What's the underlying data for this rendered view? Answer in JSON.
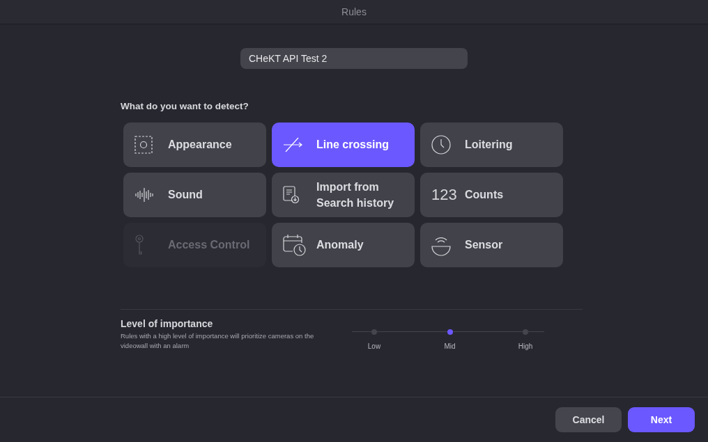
{
  "window": {
    "title": "Rules"
  },
  "rule_name": {
    "value": "CHeKT API Test 2"
  },
  "question": "What do you want to detect?",
  "detection_types": [
    {
      "label": "Appearance",
      "kind": "appearance",
      "selected": false,
      "disabled": false
    },
    {
      "label": "Line crossing",
      "kind": "line",
      "selected": true,
      "disabled": false
    },
    {
      "label": "Loitering",
      "kind": "clock",
      "selected": false,
      "disabled": false
    },
    {
      "label": "Sound",
      "kind": "sound",
      "selected": false,
      "disabled": false
    },
    {
      "label": "Import from Search history",
      "kind": "import",
      "selected": false,
      "disabled": false
    },
    {
      "label": "Counts",
      "kind": "counts",
      "icon_text": "123",
      "selected": false,
      "disabled": false
    },
    {
      "label": "Access Control",
      "kind": "key",
      "selected": false,
      "disabled": true
    },
    {
      "label": "Anomaly",
      "kind": "calendar",
      "selected": false,
      "disabled": false
    },
    {
      "label": "Sensor",
      "kind": "sensor",
      "selected": false,
      "disabled": false
    }
  ],
  "importance": {
    "title": "Level of importance",
    "description": "Rules with a high level of importance will prioritize cameras on the videowall with an alarm",
    "levels": [
      {
        "label": "Low",
        "selected": false
      },
      {
        "label": "Mid",
        "selected": true
      },
      {
        "label": "High",
        "selected": false
      }
    ]
  },
  "buttons": [
    {
      "label": "Cancel",
      "kind": "secondary"
    },
    {
      "label": "Next",
      "kind": "primary"
    }
  ]
}
